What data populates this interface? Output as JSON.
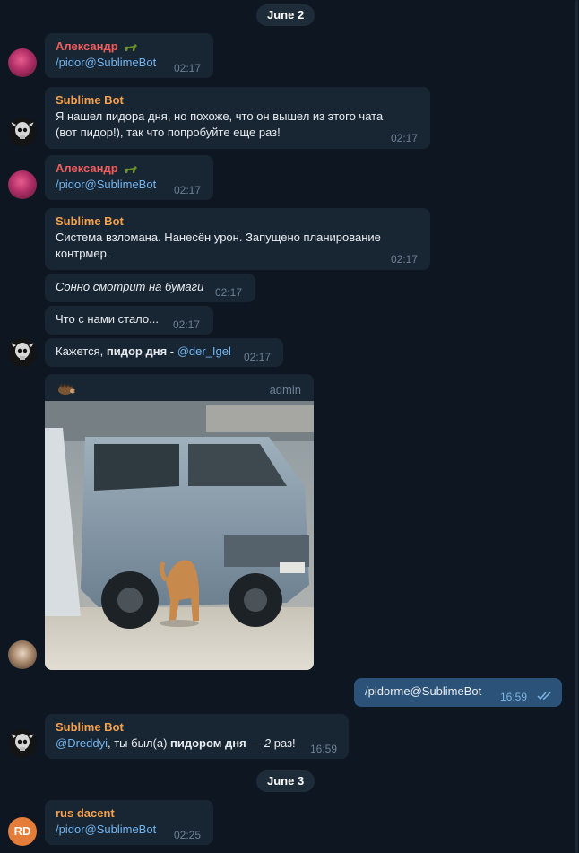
{
  "dates": {
    "first": "June 2",
    "second": "June 3"
  },
  "messages": [
    {
      "sender": "Александр",
      "text": "/pidor@SublimeBot",
      "time": "02:17"
    },
    {
      "sender": "Sublime Bot",
      "text": "Я нашел пидора дня, но похоже, что он вышел из этого чата (вот пидор!), так что попробуйте еще раз!",
      "line1": "Я нашел пидора дня, но похоже, что он вышел из этого чата",
      "line2": "(вот пидор!), так что попробуйте еще раз!",
      "time": "02:17"
    },
    {
      "sender": "Александр",
      "text": "/pidor@SublimeBot",
      "time": "02:17"
    },
    {
      "sender": "Sublime Bot",
      "line1": "Система взломана. Нанесён урон. Запущено планирование",
      "line2": "контрмер.",
      "time": "02:17"
    },
    {
      "text": "Сонно смотрит на бумаги",
      "time": "02:17"
    },
    {
      "text": "Что с нами стало...",
      "time": "02:17"
    },
    {
      "prefix": "Кажется, ",
      "bold": "пидор дня",
      "sep": " - ",
      "mention": "@der_Igel",
      "time": "02:17"
    },
    {
      "tag": "admin",
      "image": "photo of a grey minivan with a cat"
    },
    {
      "text": "/pidorme@SublimeBot",
      "time": "16:59",
      "status": "read"
    },
    {
      "sender": "Sublime Bot",
      "mention": "@Dreddyi",
      "mid": ", ты был(а) ",
      "bold": "пидором дня",
      "dash": " — ",
      "count": "2",
      "suffix": " раз!",
      "time": "16:59"
    },
    {
      "sender": "rus dacent",
      "text": "/pidor@SublimeBot",
      "time": "02:25",
      "avatar_initials": "RD"
    }
  ],
  "colors": {
    "background": "#0e1621",
    "bubble_in": "#182533",
    "bubble_out": "#2b5278",
    "sender_red": "#f05e5e",
    "sender_orange": "#f6a14c",
    "link": "#71b5f0"
  }
}
